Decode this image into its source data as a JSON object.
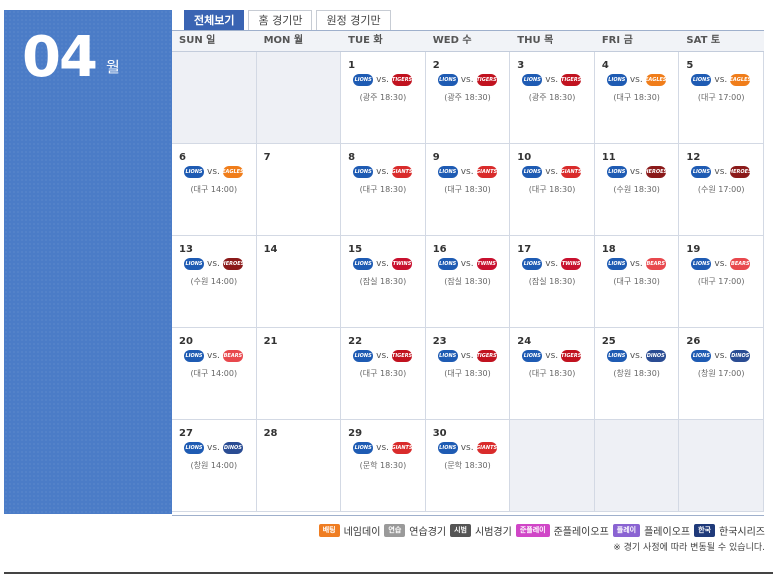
{
  "month": {
    "number": "04",
    "unit": "월"
  },
  "tabs": [
    "전체보기",
    "홈 경기만",
    "원정 경기만"
  ],
  "days_of_week": [
    "SUN 일",
    "MON 월",
    "TUE 화",
    "WED 수",
    "THU 목",
    "FRI 금",
    "SAT 토"
  ],
  "weeks": [
    [
      null,
      null,
      {
        "date": "1",
        "vs": "vs.",
        "opp": "twins",
        "info": "(광주 18:30)"
      },
      {
        "date": "2",
        "vs": "vs.",
        "opp": "twins",
        "info": "(광주 18:30)"
      },
      {
        "date": "3",
        "vs": "vs.",
        "opp": "twins",
        "info": "(광주 18:30)"
      },
      {
        "date": "4",
        "vs": "vs.",
        "opp": "eagles",
        "info": "(대구 18:30)"
      },
      {
        "date": "5",
        "vs": "vs.",
        "opp": "eagles",
        "info": "(대구 17:00)"
      }
    ],
    [
      {
        "date": "6",
        "vs": "vs.",
        "opp": "eagles",
        "info": "(대구 14:00)"
      },
      {
        "date": "7"
      },
      {
        "date": "8",
        "vs": "vs.",
        "opp": "giants",
        "info": "(대구 18:30)"
      },
      {
        "date": "9",
        "vs": "vs.",
        "opp": "giants",
        "info": "(대구 18:30)"
      },
      {
        "date": "10",
        "vs": "vs.",
        "opp": "giants",
        "info": "(대구 18:30)"
      },
      {
        "date": "11",
        "vs": "vs.",
        "opp": "heroes",
        "info": "(수원 18:30)"
      },
      {
        "date": "12",
        "vs": "vs.",
        "opp": "heroes",
        "info": "(수원 17:00)"
      }
    ],
    [
      {
        "date": "13",
        "vs": "vs.",
        "opp": "heroes",
        "info": "(수원 14:00)"
      },
      {
        "date": "14"
      },
      {
        "date": "15",
        "vs": "vs.",
        "opp": "twinsb",
        "info": "(잠실 18:30)"
      },
      {
        "date": "16",
        "vs": "vs.",
        "opp": "twinsb",
        "info": "(잠실 18:30)"
      },
      {
        "date": "17",
        "vs": "vs.",
        "opp": "twinsb",
        "info": "(잠실 18:30)"
      },
      {
        "date": "18",
        "vs": "vs.",
        "opp": "bears",
        "info": "(대구 18:30)"
      },
      {
        "date": "19",
        "vs": "vs.",
        "opp": "bears",
        "info": "(대구 17:00)"
      }
    ],
    [
      {
        "date": "20",
        "vs": "vs.",
        "opp": "bears",
        "info": "(대구 14:00)"
      },
      {
        "date": "21"
      },
      {
        "date": "22",
        "vs": "vs.",
        "opp": "twins",
        "info": "(대구 18:30)"
      },
      {
        "date": "23",
        "vs": "vs.",
        "opp": "twins",
        "info": "(대구 18:30)"
      },
      {
        "date": "24",
        "vs": "vs.",
        "opp": "twins",
        "info": "(대구 18:30)"
      },
      {
        "date": "25",
        "vs": "vs.",
        "opp": "dinos",
        "info": "(창원 18:30)"
      },
      {
        "date": "26",
        "vs": "vs.",
        "opp": "dinos",
        "info": "(창원 17:00)"
      }
    ],
    [
      {
        "date": "27",
        "vs": "vs.",
        "opp": "dinos",
        "info": "(창원 14:00)"
      },
      {
        "date": "28"
      },
      {
        "date": "29",
        "vs": "vs.",
        "opp": "giants",
        "info": "(문학 18:30)"
      },
      {
        "date": "30",
        "vs": "vs.",
        "opp": "giants",
        "info": "(문학 18:30)"
      },
      null,
      null,
      null
    ]
  ],
  "team_logos": {
    "home": {
      "text": "LIONS",
      "color": "#1e5bb3"
    },
    "twins": {
      "text": "TIGERS",
      "color": "#c1121f"
    },
    "eagles": {
      "text": "EAGLES",
      "color": "#f07d1a"
    },
    "giants": {
      "text": "GIANTS",
      "color": "#d92b2b"
    },
    "heroes": {
      "text": "HEROES",
      "color": "#8b1a1a"
    },
    "twinsb": {
      "text": "TWINS",
      "color": "#c8102e"
    },
    "bears": {
      "text": "BEARS",
      "color": "#e8484d"
    },
    "dinos": {
      "text": "DINOS",
      "color": "#2a4c93"
    }
  },
  "legend": [
    {
      "badge": "배팅",
      "label": "네임데이",
      "color": "#ef7d22"
    },
    {
      "badge": "연습",
      "label": "연습경기",
      "color": "#9a9a9a"
    },
    {
      "badge": "시범",
      "label": "시범경기",
      "color": "#555555"
    },
    {
      "badge": "준플레이",
      "label": "준플레이오프",
      "color": "#d046c7"
    },
    {
      "badge": "플레이",
      "label": "플레이오프",
      "color": "#8a63d2"
    },
    {
      "badge": "한국",
      "label": "한국시리즈",
      "color": "#1f3a7a"
    }
  ],
  "notice": "※ 경기 사정에 따라 변동될 수 있습니다."
}
